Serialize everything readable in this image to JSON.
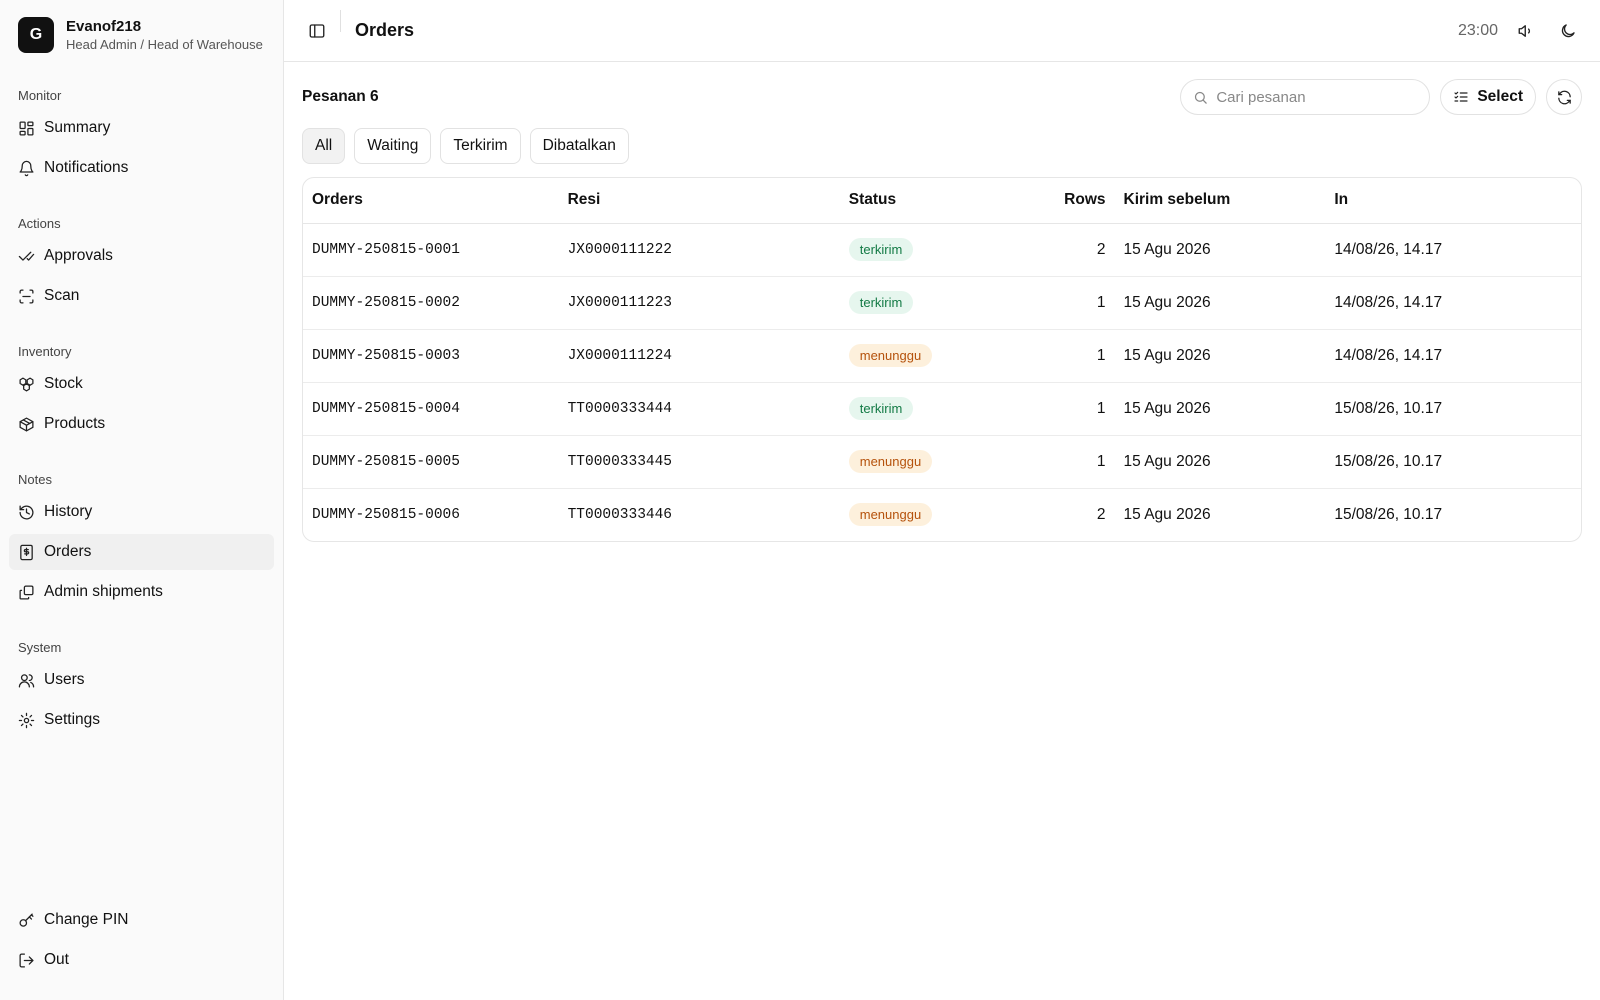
{
  "profile": {
    "avatar_initial": "G",
    "name": "Evanof218",
    "role": "Head Admin / Head of Warehouse"
  },
  "sidebar": {
    "groups": [
      {
        "label": "Monitor",
        "items": [
          {
            "label": "Summary",
            "icon": "layout-dashboard-icon"
          },
          {
            "label": "Notifications",
            "icon": "bell-icon"
          }
        ]
      },
      {
        "label": "Actions",
        "items": [
          {
            "label": "Approvals",
            "icon": "check-check-icon"
          },
          {
            "label": "Scan",
            "icon": "scan-icon"
          }
        ]
      },
      {
        "label": "Inventory",
        "items": [
          {
            "label": "Stock",
            "icon": "boxes-icon"
          },
          {
            "label": "Products",
            "icon": "package-icon"
          }
        ]
      },
      {
        "label": "Notes",
        "items": [
          {
            "label": "History",
            "icon": "history-icon"
          },
          {
            "label": "Orders",
            "icon": "receipt-icon",
            "active": true
          },
          {
            "label": "Admin shipments",
            "icon": "copy-icon"
          }
        ]
      },
      {
        "label": "System",
        "items": [
          {
            "label": "Users",
            "icon": "users-icon"
          },
          {
            "label": "Settings",
            "icon": "gear-icon"
          }
        ]
      }
    ],
    "bottom": [
      {
        "label": "Change PIN",
        "icon": "key-icon"
      },
      {
        "label": "Out",
        "icon": "log-out-icon"
      }
    ]
  },
  "header": {
    "title": "Orders",
    "clock": "23:00"
  },
  "main": {
    "orders_label": "Pesanan 6",
    "search_placeholder": "Cari pesanan",
    "select_label": "Select",
    "tabs": [
      {
        "label": "All",
        "active": true
      },
      {
        "label": "Waiting"
      },
      {
        "label": "Terkirim"
      },
      {
        "label": "Dibatalkan"
      }
    ]
  },
  "table": {
    "columns": [
      "Orders",
      "Resi",
      "Status",
      "Rows",
      "Kirim sebelum",
      "In"
    ],
    "rows": [
      {
        "order": "DUMMY-250815-0001",
        "resi": "JX0000111222",
        "status": "terkirim",
        "rows": "2",
        "kirim": "15 Agu 2026",
        "in": "14/08/26, 14.17"
      },
      {
        "order": "DUMMY-250815-0002",
        "resi": "JX0000111223",
        "status": "terkirim",
        "rows": "1",
        "kirim": "15 Agu 2026",
        "in": "14/08/26, 14.17"
      },
      {
        "order": "DUMMY-250815-0003",
        "resi": "JX0000111224",
        "status": "menunggu",
        "rows": "1",
        "kirim": "15 Agu 2026",
        "in": "14/08/26, 14.17"
      },
      {
        "order": "DUMMY-250815-0004",
        "resi": "TT0000333444",
        "status": "terkirim",
        "rows": "1",
        "kirim": "15 Agu 2026",
        "in": "15/08/26, 10.17"
      },
      {
        "order": "DUMMY-250815-0005",
        "resi": "TT0000333445",
        "status": "menunggu",
        "rows": "1",
        "kirim": "15 Agu 2026",
        "in": "15/08/26, 10.17"
      },
      {
        "order": "DUMMY-250815-0006",
        "resi": "TT0000333446",
        "status": "menunggu",
        "rows": "2",
        "kirim": "15 Agu 2026",
        "in": "15/08/26, 10.17"
      }
    ]
  },
  "colors": {
    "status_sent_bg": "#e6f6ee",
    "status_sent_fg": "#137a45",
    "status_wait_bg": "#fdf0dc",
    "status_wait_fg": "#b5520c",
    "active_nav_bg": "#f0f0f0"
  }
}
